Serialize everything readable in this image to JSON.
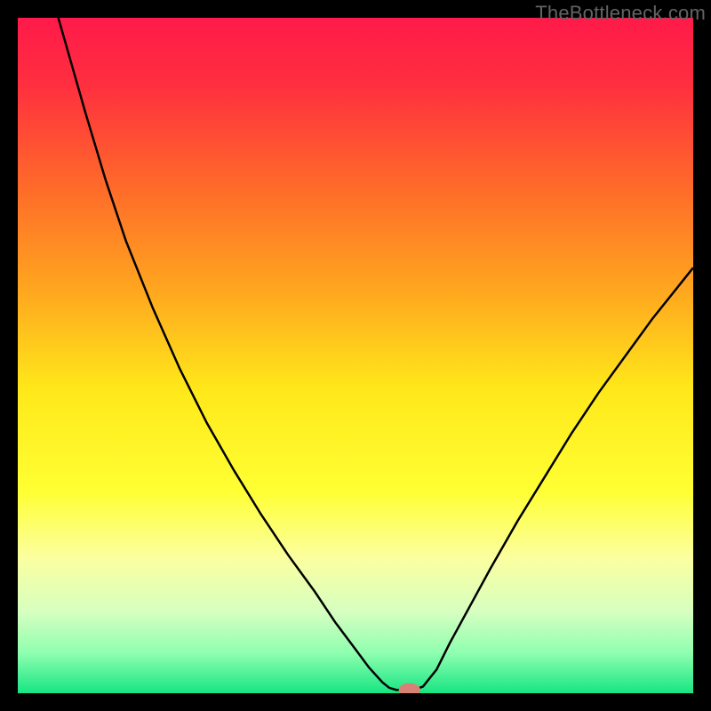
{
  "watermark": "TheBottleneck.com",
  "chart_data": {
    "type": "line",
    "title": "",
    "xlabel": "",
    "ylabel": "",
    "xlim": [
      0,
      100
    ],
    "ylim": [
      0,
      100
    ],
    "background_gradient": {
      "stops": [
        {
          "offset": 0.0,
          "color": "#ff1a4a"
        },
        {
          "offset": 0.1,
          "color": "#ff2f3f"
        },
        {
          "offset": 0.25,
          "color": "#ff6a2a"
        },
        {
          "offset": 0.4,
          "color": "#ffa51f"
        },
        {
          "offset": 0.55,
          "color": "#ffe81a"
        },
        {
          "offset": 0.7,
          "color": "#ffff33"
        },
        {
          "offset": 0.8,
          "color": "#fbffa0"
        },
        {
          "offset": 0.88,
          "color": "#d6ffc0"
        },
        {
          "offset": 0.94,
          "color": "#8fffb0"
        },
        {
          "offset": 1.0,
          "color": "#17e583"
        }
      ]
    },
    "series": [
      {
        "name": "bottleneck-curve",
        "color": "#000000",
        "width": 2.5,
        "points": [
          {
            "x": 6.0,
            "y": 100.0
          },
          {
            "x": 8.0,
            "y": 93.0
          },
          {
            "x": 10.0,
            "y": 86.0
          },
          {
            "x": 13.0,
            "y": 76.0
          },
          {
            "x": 16.0,
            "y": 67.0
          },
          {
            "x": 20.0,
            "y": 57.0
          },
          {
            "x": 24.0,
            "y": 48.0
          },
          {
            "x": 28.0,
            "y": 40.0
          },
          {
            "x": 32.0,
            "y": 33.0
          },
          {
            "x": 36.0,
            "y": 26.5
          },
          {
            "x": 40.0,
            "y": 20.5
          },
          {
            "x": 44.0,
            "y": 15.0
          },
          {
            "x": 47.0,
            "y": 10.5
          },
          {
            "x": 50.0,
            "y": 6.5
          },
          {
            "x": 52.0,
            "y": 3.8
          },
          {
            "x": 54.0,
            "y": 1.6
          },
          {
            "x": 55.0,
            "y": 0.8
          },
          {
            "x": 56.0,
            "y": 0.5
          },
          {
            "x": 58.0,
            "y": 0.5
          },
          {
            "x": 59.0,
            "y": 0.6
          },
          {
            "x": 60.0,
            "y": 1.0
          },
          {
            "x": 62.0,
            "y": 3.5
          },
          {
            "x": 64.0,
            "y": 7.5
          },
          {
            "x": 67.0,
            "y": 13.0
          },
          {
            "x": 70.0,
            "y": 18.5
          },
          {
            "x": 74.0,
            "y": 25.5
          },
          {
            "x": 78.0,
            "y": 32.0
          },
          {
            "x": 82.0,
            "y": 38.5
          },
          {
            "x": 86.0,
            "y": 44.5
          },
          {
            "x": 90.0,
            "y": 50.0
          },
          {
            "x": 94.0,
            "y": 55.5
          },
          {
            "x": 98.0,
            "y": 60.5
          },
          {
            "x": 100.0,
            "y": 63.0
          }
        ]
      }
    ],
    "marker": {
      "x": 58.0,
      "y": 0.5,
      "rx": 1.6,
      "ry": 1.0,
      "color": "#d98177"
    }
  }
}
